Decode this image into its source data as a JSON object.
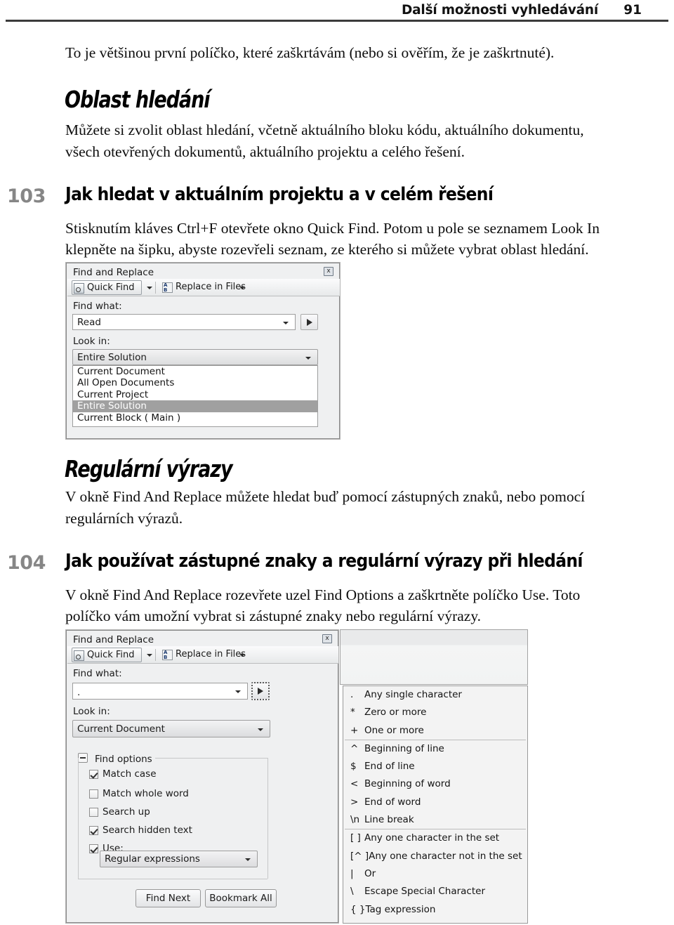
{
  "header": {
    "title": "Další možnosti vyhledávání",
    "page_number": "91"
  },
  "intro_paragraph": "To je většinou první políčko, které zaškrtávám (nebo si ověřím, že je zaškrtnuté).",
  "section_oblast": {
    "title": "Oblast hledání",
    "paragraph_line1": "Můžete si zvolit oblast hledání, včetně aktuálního bloku kódu, aktuálního dokumentu,",
    "paragraph_line2": "všech otevřených dokumentů, aktuálního projektu a celého řešení."
  },
  "tip_103": {
    "number": "103",
    "title": "Jak hledat v aktuálním projektu a v celém řešení",
    "paragraph_line1": "Stisknutím kláves Ctrl+F otevřete okno Quick Find. Potom u pole se seznamem Look In",
    "paragraph_line2": "klepněte na šipku, abyste rozevřeli seznam, ze kterého si můžete vybrat oblast hledání."
  },
  "dialog_1": {
    "title": "Find and Replace",
    "close_label": "x",
    "toolbar": {
      "quick_find_label": "Quick Find",
      "replace_in_files_label": "Replace in Files"
    },
    "find_what_label": "Find what:",
    "find_what_value": "Read",
    "look_in_label": "Look in:",
    "look_in_value": "Entire Solution",
    "dropdown_options": [
      "Current Document",
      "All Open Documents",
      "Current Project",
      "Entire Solution",
      "Current Block ( Main )"
    ],
    "dropdown_selected_index": 3
  },
  "section_regex": {
    "title": "Regulární výrazy",
    "paragraph_line1": "V okně Find And Replace můžete hledat buď pomocí zástupných znaků, nebo pomocí",
    "paragraph_line2": "regulárních výrazů."
  },
  "tip_104": {
    "number": "104",
    "title": "Jak používat zástupné znaky a regulární výrazy při hledání",
    "paragraph_line1": "V okně Find And Replace rozevřete uzel Find Options a zaškrtněte políčko Use. Toto",
    "paragraph_line2": "políčko vám umožní vybrat si zástupné znaky nebo regulární výrazy."
  },
  "dialog_2": {
    "title": "Find and Replace",
    "close_label": "x",
    "toolbar": {
      "quick_find_label": "Quick Find",
      "replace_in_files_label": "Replace in Files"
    },
    "find_what_label": "Find what:",
    "find_what_value": ".",
    "look_in_label": "Look in:",
    "look_in_value": "Current Document",
    "find_options_label": "Find options",
    "checkboxes": [
      {
        "label": "Match case",
        "checked": true
      },
      {
        "label": "Match whole word",
        "checked": false
      },
      {
        "label": "Search up",
        "checked": false
      },
      {
        "label": "Search hidden text",
        "checked": true
      },
      {
        "label": "Use:",
        "checked": true
      }
    ],
    "use_value": "Regular expressions",
    "buttons": {
      "find_next": "Find Next",
      "bookmark_all": "Bookmark All"
    }
  },
  "regex_menu": {
    "groups": [
      [
        {
          "symbol": ".",
          "desc": "Any single character"
        },
        {
          "symbol": "*",
          "desc": "Zero or more"
        },
        {
          "symbol": "+",
          "desc": "One or more"
        }
      ],
      [
        {
          "symbol": "^",
          "desc": "Beginning of line"
        },
        {
          "symbol": "$",
          "desc": "End of line"
        },
        {
          "symbol": "<",
          "desc": "Beginning of word"
        },
        {
          "symbol": ">",
          "desc": "End of word"
        },
        {
          "symbol": "\\n",
          "desc": "Line break"
        }
      ],
      [
        {
          "symbol": "[ ]",
          "desc": "Any one character in the set"
        },
        {
          "symbol": "[^ ]",
          "desc": "Any one character not in the set"
        },
        {
          "symbol": "|",
          "desc": "Or"
        },
        {
          "symbol": "\\",
          "desc": "Escape Special Character"
        },
        {
          "symbol": "{ }",
          "desc": "Tag expression"
        }
      ]
    ]
  }
}
